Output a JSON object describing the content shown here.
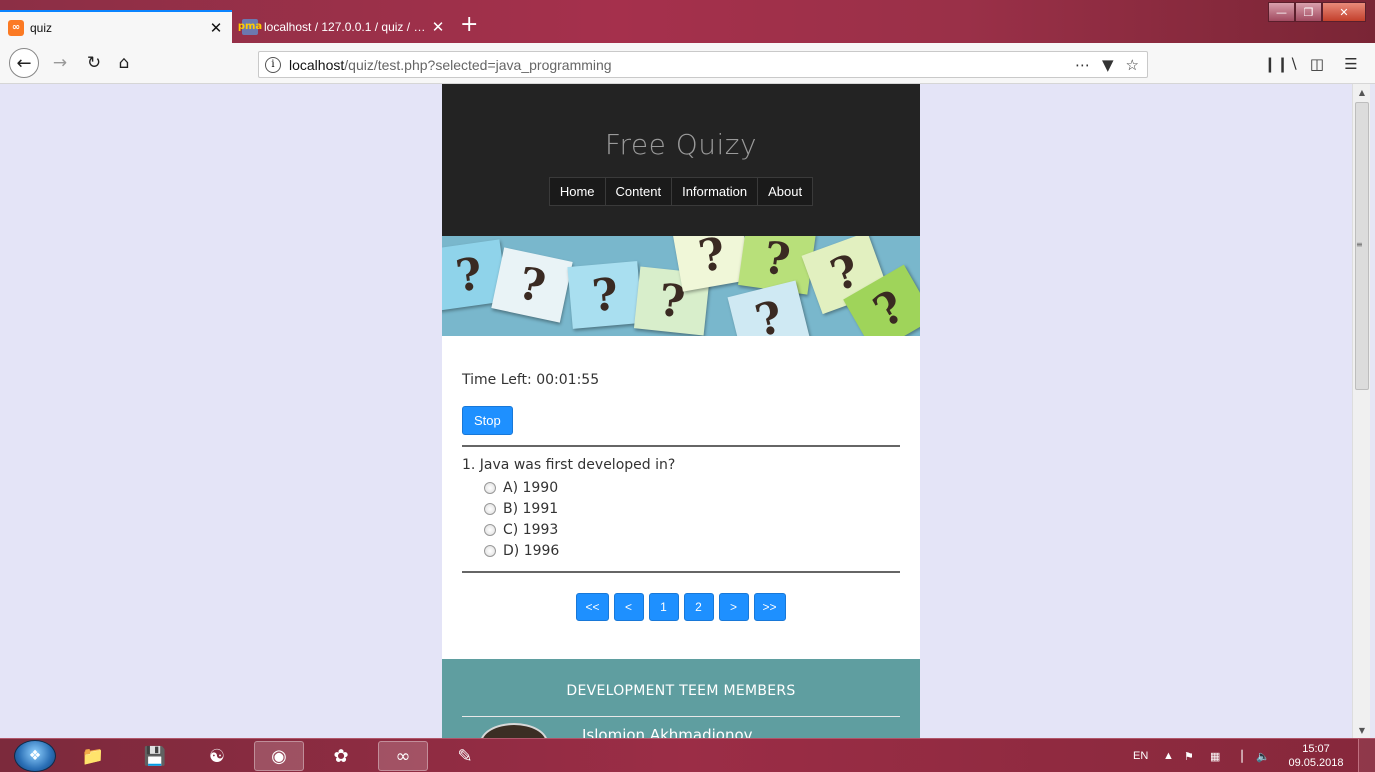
{
  "browser": {
    "tabs": [
      {
        "title": "quiz",
        "active": true,
        "favicon": "xampp-icon"
      },
      {
        "title": "localhost / 127.0.0.1 / quiz / users",
        "active": false,
        "favicon": "phpmyadmin-icon"
      }
    ],
    "url": {
      "host": "localhost",
      "path": "/quiz/test.php?selected=java_programming"
    },
    "accent": "#0a84ff"
  },
  "site": {
    "title": "Free Quizy",
    "menu": [
      "Home",
      "Content",
      "Information",
      "About"
    ],
    "banner_glyph": "?"
  },
  "quiz": {
    "time_left": "Time Left: 00:01:55",
    "stop_label": "Stop",
    "question": "1. Java was first developed in?",
    "options": [
      "A) 1990",
      "B) 1991",
      "C) 1993",
      "D) 1996"
    ],
    "pager": [
      "<<",
      "<",
      "1",
      "2",
      ">",
      ">>"
    ],
    "button_color": "#1e90ff"
  },
  "footer": {
    "title": "DEVELOPMENT TEEM MEMBERS",
    "member_name": "Islomjon Akhmadjonov",
    "color": "#5f9ea0"
  },
  "taskbar": {
    "lang": "EN",
    "time": "15:07",
    "date": "09.05.2018"
  }
}
